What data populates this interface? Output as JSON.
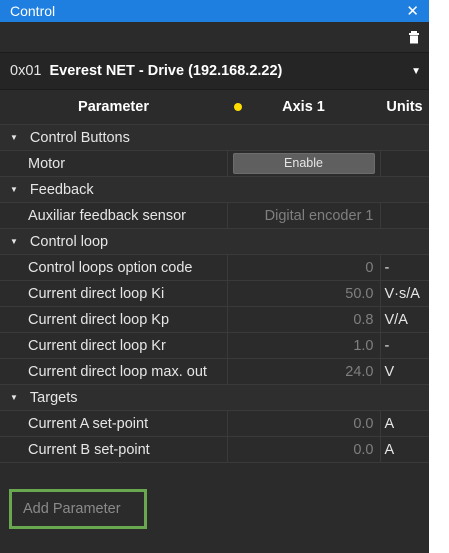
{
  "window": {
    "title": "Control",
    "close_glyph": "✕"
  },
  "drive": {
    "address": "0x01",
    "name": "Everest NET - Drive (192.168.2.22)"
  },
  "table": {
    "headers": {
      "parameter": "Parameter",
      "axis": "Axis 1",
      "units": "Units"
    },
    "axis_status_color": "#ffdd00",
    "groups": [
      {
        "label": "Control Buttons",
        "rows": [
          {
            "name": "Motor",
            "button": "Enable",
            "unit": ""
          }
        ]
      },
      {
        "label": "Feedback",
        "rows": [
          {
            "name": "Auxiliar feedback sensor",
            "value": "Digital encoder 1",
            "unit": ""
          }
        ]
      },
      {
        "label": "Control loop",
        "rows": [
          {
            "name": "Control loops option code",
            "value": "0",
            "unit": "-"
          },
          {
            "name": "Current direct loop Ki",
            "value": "50.0",
            "unit": "V·s/A"
          },
          {
            "name": "Current direct loop Kp",
            "value": "0.8",
            "unit": "V/A"
          },
          {
            "name": "Current direct loop Kr",
            "value": "1.0",
            "unit": "-"
          },
          {
            "name": "Current direct loop max. out",
            "value": "24.0",
            "unit": "V"
          }
        ]
      },
      {
        "label": "Targets",
        "rows": [
          {
            "name": "Current A set-point",
            "value": "0.0",
            "unit": "A"
          },
          {
            "name": "Current B set-point",
            "value": "0.0",
            "unit": "A"
          }
        ]
      }
    ]
  },
  "add_parameter_label": "Add Parameter",
  "colors": {
    "titlebar": "#1e7fe0",
    "panel": "#2b2b2b",
    "highlight_border": "#6aa84f"
  }
}
